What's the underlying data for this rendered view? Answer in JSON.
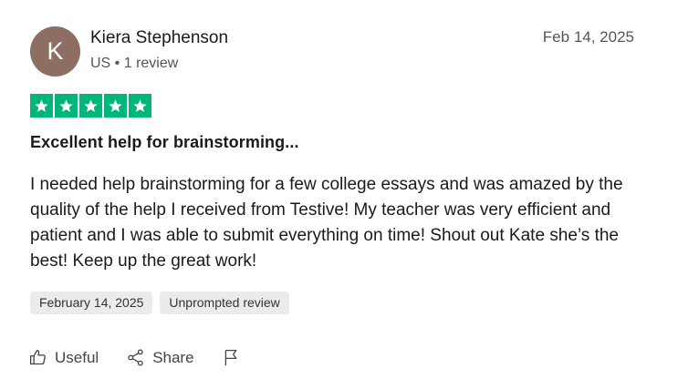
{
  "reviewer": {
    "initial": "K",
    "name": "Kiera Stephenson",
    "meta": "US • 1 review",
    "avatar_color": "#8e6e62"
  },
  "review": {
    "date": "Feb 14, 2025",
    "rating": 5,
    "rating_max": 5,
    "star_color": "#00b67a",
    "title": "Excellent help for brainstorming...",
    "body": "I needed help brainstorming for a few college essays and was amazed by the quality of the help I received from Testive! My teacher was very efficient and patient and I was able to submit everything on time! Shout out Kate she’s the best! Keep up the great work!",
    "tags": [
      "February 14, 2025",
      "Unprompted review"
    ]
  },
  "actions": {
    "useful_label": "Useful",
    "share_label": "Share",
    "useful_icon": "thumbs-up-icon",
    "share_icon": "share-icon",
    "report_icon": "flag-icon"
  }
}
